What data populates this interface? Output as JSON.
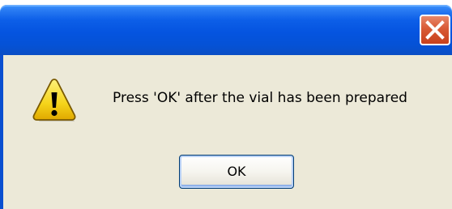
{
  "dialog": {
    "title": "",
    "message": "Press 'OK' after the vial has been prepared",
    "ok_label": "OK",
    "icon": "warning-icon",
    "close_icon": "close-icon"
  },
  "colors": {
    "titlebar": "#0554e0",
    "body": "#ece9d8",
    "close_button": "#d85a35",
    "warning_yellow": "#f5d41a"
  }
}
